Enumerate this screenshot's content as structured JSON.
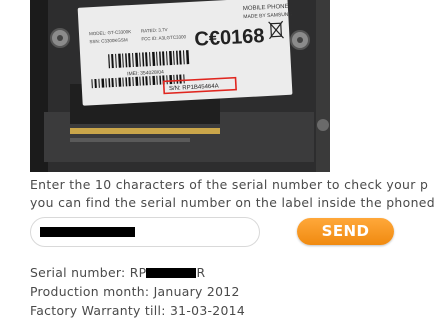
{
  "photo": {
    "label_brand": "MOBILE PHONE",
    "label_maker": "MADE BY SAMSUNG",
    "label_model": "MODEL: GT-C3300K",
    "label_rated": "RATED: 3.7V",
    "label_ssn": "SSN: C3300KGSM",
    "label_fcc": "FCC ID: A3LGTC3300",
    "label_imei": "IMEI: 354028/04",
    "label_ce": "C€0168",
    "label_serial": "S/N: RP1B45464A"
  },
  "instructions": {
    "line1": "Enter the 10 characters of the serial number to check your p",
    "line2": "you can find the serial number on the label inside the phoned"
  },
  "form": {
    "serial_value": "",
    "send_label": "SEND"
  },
  "result": {
    "serial_prefix": "Serial number: RP",
    "serial_suffix": "R",
    "production": "Production month: January 2012",
    "warranty": "Factory Warranty till: 31-03-2014"
  }
}
